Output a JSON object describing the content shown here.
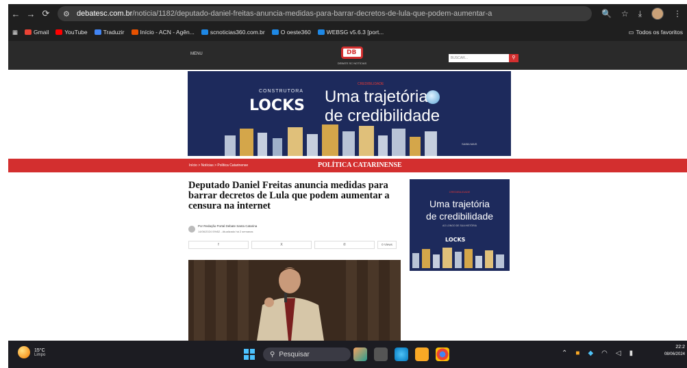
{
  "browser": {
    "url_host": "debatesc.com.br",
    "url_path": "/noticia/1182/deputado-daniel-freitas-anuncia-medidas-para-barrar-decretos-de-lula-que-podem-aumentar-a",
    "icons": [
      "back-icon",
      "forward-icon",
      "reload-icon",
      "site-info-icon",
      "zoom-icon",
      "star-icon",
      "download-icon",
      "profile-avatar",
      "menu-icon"
    ]
  },
  "bookmarks": {
    "items": [
      {
        "label": "Gmail",
        "color": "#ea4335"
      },
      {
        "label": "YouTube",
        "color": "#ff0000"
      },
      {
        "label": "Traduzir",
        "color": "#4285f4"
      },
      {
        "label": "Início - ACN - Agên...",
        "color": "#e65100"
      },
      {
        "label": "scnoticias360.com.br",
        "color": "#1e88e5"
      },
      {
        "label": "O oeste360",
        "color": "#1e88e5"
      },
      {
        "label": "WEBSG v5.6.3 [port...",
        "color": "#1e88e5"
      }
    ],
    "folder": "Todos os favoritos"
  },
  "site": {
    "menu_label": "MENU",
    "logo_text": "DB",
    "logo_sub": "DEBATE SC NOTÍCIAS",
    "search_placeholder": "BUSCAR...",
    "accent_color": "#d32f2f"
  },
  "banner": {
    "construtora": "CONSTRUTORA",
    "brand": "LOCKS",
    "tag": "CREDIBILIDADE",
    "headline_1": "Uma trajetória",
    "headline_2": "de credibilidade",
    "small_print": "SAIBA MAIS"
  },
  "section": {
    "crumbs": "Início  >  Notícias  >  Política Catarinense",
    "title": "POLÍTICA CATARINENSE"
  },
  "article": {
    "headline": "Deputado Daniel Freitas anuncia medidas para barrar decretos de Lula que podem aumentar a censura na internet",
    "author": "Por Redação Portal Debate Santa Catarina",
    "date": "14/06/2024 09h52 - Atualizado há 2 semanas",
    "share_buttons": [
      "f",
      "X",
      "✆"
    ],
    "share_count": "0 Views"
  },
  "side_ad": {
    "red_tag": "CREDIBILIDADE",
    "headline_1": "Uma trajetória",
    "headline_2": "de credibilidade",
    "small_print": "AO LONGO DE SUA HISTÓRIA",
    "brand": "LOCKS"
  },
  "taskbar": {
    "weather_temp": "15°C",
    "weather_desc": "Limpo",
    "search_label": "Pesquisar",
    "time": "22:2",
    "date": "08/06/2024"
  }
}
